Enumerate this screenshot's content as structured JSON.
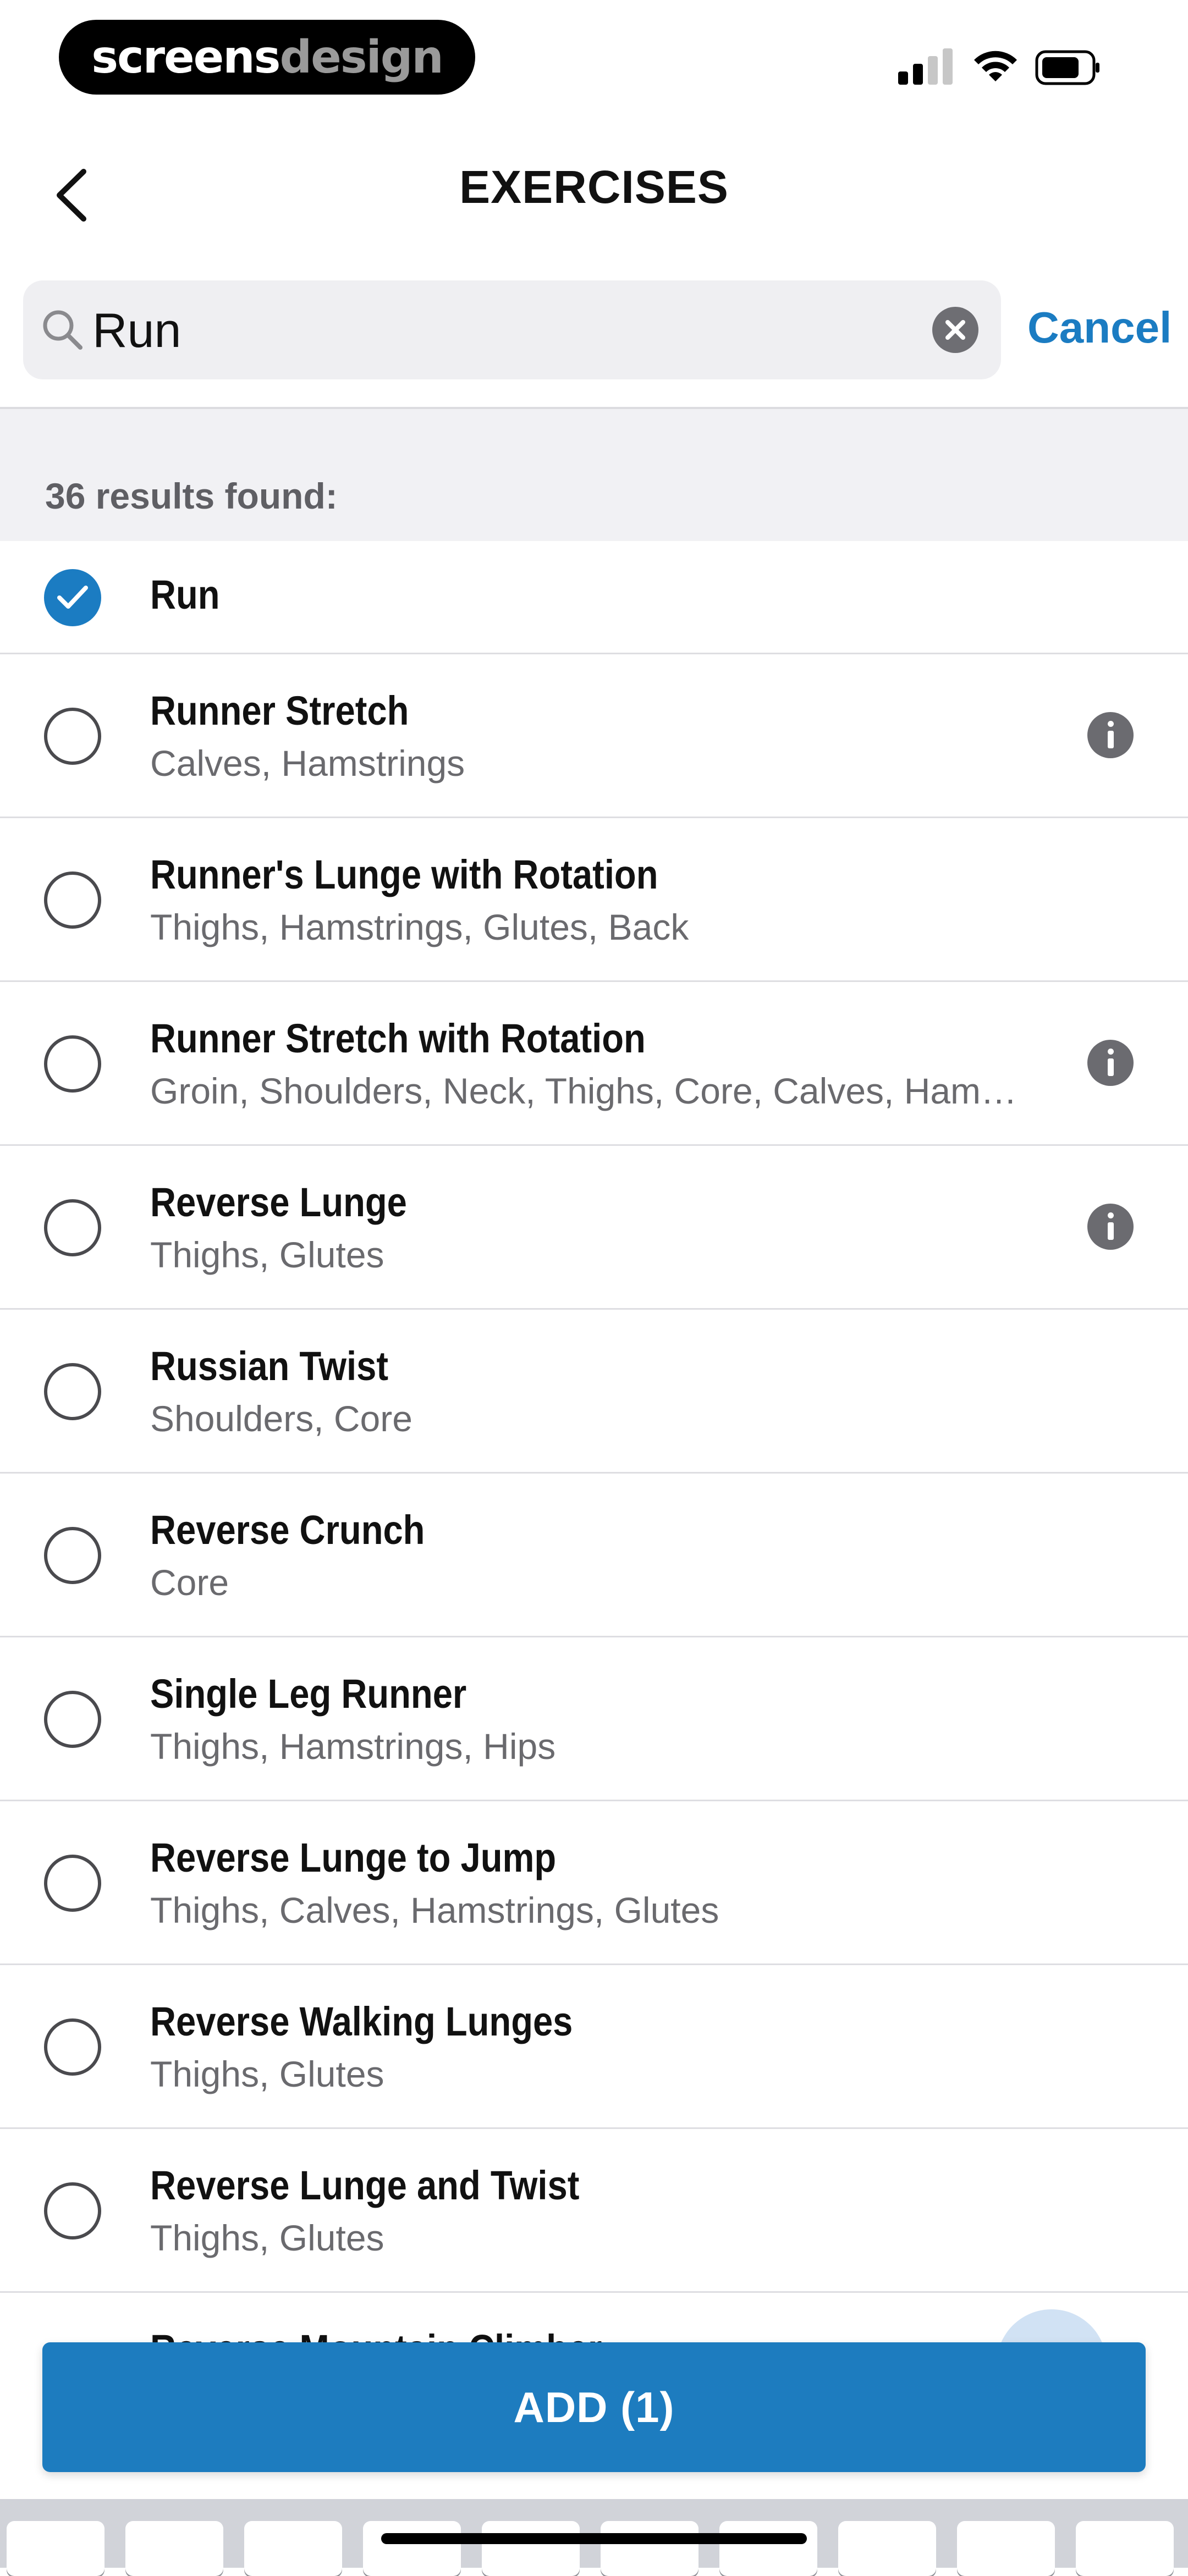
{
  "status_bar": {
    "brand_part1": "screens",
    "brand_part2": "design"
  },
  "nav": {
    "title": "EXERCISES"
  },
  "search": {
    "value": "Run",
    "cancel_label": "Cancel"
  },
  "results": {
    "count_text": "36 results found:"
  },
  "exercises": [
    {
      "name": "Run",
      "muscles": "",
      "checked": true,
      "info": false
    },
    {
      "name": "Runner Stretch",
      "muscles": "Calves, Hamstrings",
      "checked": false,
      "info": true
    },
    {
      "name": "Runner's Lunge with Rotation",
      "muscles": "Thighs, Hamstrings, Glutes, Back",
      "checked": false,
      "info": false
    },
    {
      "name": "Runner Stretch with Rotation",
      "muscles": "Groin, Shoulders, Neck, Thighs, Core, Calves, Ham…",
      "checked": false,
      "info": true
    },
    {
      "name": "Reverse Lunge",
      "muscles": "Thighs, Glutes",
      "checked": false,
      "info": true
    },
    {
      "name": "Russian Twist",
      "muscles": "Shoulders, Core",
      "checked": false,
      "info": false
    },
    {
      "name": "Reverse Crunch",
      "muscles": "Core",
      "checked": false,
      "info": false
    },
    {
      "name": "Single Leg Runner",
      "muscles": "Thighs, Hamstrings, Hips",
      "checked": false,
      "info": false
    },
    {
      "name": "Reverse Lunge to Jump",
      "muscles": "Thighs, Calves, Hamstrings, Glutes",
      "checked": false,
      "info": false
    },
    {
      "name": "Reverse Walking Lunges",
      "muscles": "Thighs, Glutes",
      "checked": false,
      "info": false
    },
    {
      "name": "Reverse Lunge and Twist",
      "muscles": "Thighs, Glutes",
      "checked": false,
      "info": false
    }
  ],
  "partial_row": {
    "name": "Reverse Mountain Climber"
  },
  "add_button": {
    "label": "ADD (1)"
  },
  "colors": {
    "accent": "#1b7cc2",
    "button": "#1d7cbf"
  }
}
